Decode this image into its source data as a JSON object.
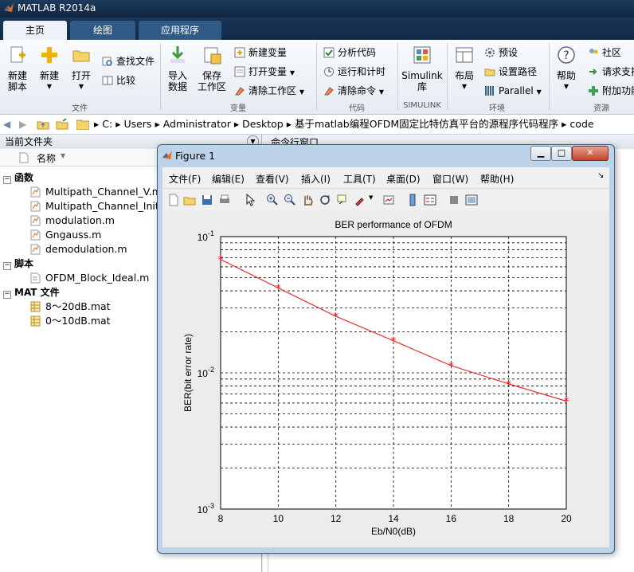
{
  "app": {
    "title": "MATLAB R2014a"
  },
  "tabs": [
    {
      "label": "主页"
    },
    {
      "label": "绘图"
    },
    {
      "label": "应用程序"
    }
  ],
  "ribbon": {
    "new_script": "新建\n脚本",
    "new": "新建",
    "open": "打开",
    "find_files": "查找文件",
    "compare": "比较",
    "import_data": "导入\n数据",
    "save_workspace": "保存\n工作区",
    "new_variable": "新建变量",
    "open_variable": "打开变量",
    "clear_workspace": "清除工作区",
    "analyze_code": "分析代码",
    "run_and_time": "运行和计时",
    "clear_commands": "清除命令",
    "simulink_library": "Simulink\n库",
    "layout": "布局",
    "preferences": "预设",
    "set_path": "设置路径",
    "parallel": "Parallel",
    "help": "帮助",
    "community": "社区",
    "request_support": "请求支持",
    "addons": "附加功能",
    "groups": {
      "file": "文件",
      "variable": "变量",
      "code": "代码",
      "simulink": "SIMULINK",
      "environment": "环境",
      "resources": "资源"
    }
  },
  "address": {
    "crumbs": [
      "C:",
      "Users",
      "Administrator",
      "Desktop",
      "基于matlab编程OFDM固定比特仿真平台的源程序代码程序",
      "code"
    ]
  },
  "left_panel": {
    "title": "当前文件夹",
    "column_name": "名称",
    "sections": [
      {
        "label": "函数",
        "items": [
          "Multipath_Channel_V.m",
          "Multipath_Channel_Init_T",
          "modulation.m",
          "Gngauss.m",
          "demodulation.m"
        ]
      },
      {
        "label": "脚本",
        "items": [
          "OFDM_Block_Ideal.m"
        ]
      },
      {
        "label": "MAT 文件",
        "items": [
          "8～20dB.mat",
          "0～10dB.mat"
        ]
      }
    ]
  },
  "command_panel": {
    "title": "命令行窗口"
  },
  "figure": {
    "title": "Figure 1",
    "menu": [
      "文件(F)",
      "编辑(E)",
      "查看(V)",
      "插入(I)",
      "工具(T)",
      "桌面(D)",
      "窗口(W)",
      "帮助(H)"
    ]
  },
  "chart_data": {
    "type": "line",
    "title": "BER performance of OFDM",
    "xlabel": "Eb/N0(dB)",
    "ylabel": "BER(bit error rate)",
    "xlim": [
      8,
      20
    ],
    "ylim": [
      0.001,
      0.1
    ],
    "yscale": "log",
    "grid": true,
    "x_ticks": [
      "8",
      "10",
      "12",
      "14",
      "16",
      "18",
      "20"
    ],
    "y_ticks": [
      {
        "base": "10",
        "exp": "-1"
      },
      {
        "base": "10",
        "exp": "-2"
      },
      {
        "base": "10",
        "exp": "-3"
      }
    ],
    "series": [
      {
        "x": [
          8,
          10,
          12,
          14,
          16,
          18,
          20
        ],
        "y": [
          0.068,
          0.042,
          0.026,
          0.0172,
          0.0113,
          0.0083,
          0.0062
        ],
        "color": "#ff0000",
        "marker": "*"
      }
    ]
  }
}
